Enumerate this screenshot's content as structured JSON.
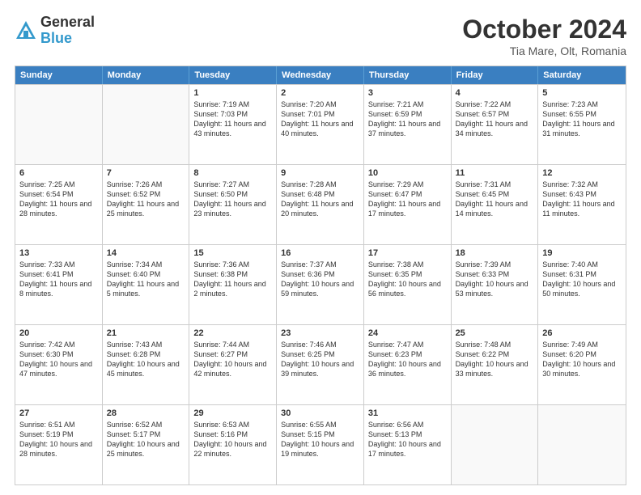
{
  "header": {
    "logo_general": "General",
    "logo_blue": "Blue",
    "month_title": "October 2024",
    "location": "Tia Mare, Olt, Romania"
  },
  "weekdays": [
    "Sunday",
    "Monday",
    "Tuesday",
    "Wednesday",
    "Thursday",
    "Friday",
    "Saturday"
  ],
  "rows": [
    [
      {
        "day": "",
        "text": "",
        "empty": true
      },
      {
        "day": "",
        "text": "",
        "empty": true
      },
      {
        "day": "1",
        "text": "Sunrise: 7:19 AM\nSunset: 7:03 PM\nDaylight: 11 hours and 43 minutes.",
        "empty": false
      },
      {
        "day": "2",
        "text": "Sunrise: 7:20 AM\nSunset: 7:01 PM\nDaylight: 11 hours and 40 minutes.",
        "empty": false
      },
      {
        "day": "3",
        "text": "Sunrise: 7:21 AM\nSunset: 6:59 PM\nDaylight: 11 hours and 37 minutes.",
        "empty": false
      },
      {
        "day": "4",
        "text": "Sunrise: 7:22 AM\nSunset: 6:57 PM\nDaylight: 11 hours and 34 minutes.",
        "empty": false
      },
      {
        "day": "5",
        "text": "Sunrise: 7:23 AM\nSunset: 6:55 PM\nDaylight: 11 hours and 31 minutes.",
        "empty": false
      }
    ],
    [
      {
        "day": "6",
        "text": "Sunrise: 7:25 AM\nSunset: 6:54 PM\nDaylight: 11 hours and 28 minutes.",
        "empty": false
      },
      {
        "day": "7",
        "text": "Sunrise: 7:26 AM\nSunset: 6:52 PM\nDaylight: 11 hours and 25 minutes.",
        "empty": false
      },
      {
        "day": "8",
        "text": "Sunrise: 7:27 AM\nSunset: 6:50 PM\nDaylight: 11 hours and 23 minutes.",
        "empty": false
      },
      {
        "day": "9",
        "text": "Sunrise: 7:28 AM\nSunset: 6:48 PM\nDaylight: 11 hours and 20 minutes.",
        "empty": false
      },
      {
        "day": "10",
        "text": "Sunrise: 7:29 AM\nSunset: 6:47 PM\nDaylight: 11 hours and 17 minutes.",
        "empty": false
      },
      {
        "day": "11",
        "text": "Sunrise: 7:31 AM\nSunset: 6:45 PM\nDaylight: 11 hours and 14 minutes.",
        "empty": false
      },
      {
        "day": "12",
        "text": "Sunrise: 7:32 AM\nSunset: 6:43 PM\nDaylight: 11 hours and 11 minutes.",
        "empty": false
      }
    ],
    [
      {
        "day": "13",
        "text": "Sunrise: 7:33 AM\nSunset: 6:41 PM\nDaylight: 11 hours and 8 minutes.",
        "empty": false
      },
      {
        "day": "14",
        "text": "Sunrise: 7:34 AM\nSunset: 6:40 PM\nDaylight: 11 hours and 5 minutes.",
        "empty": false
      },
      {
        "day": "15",
        "text": "Sunrise: 7:36 AM\nSunset: 6:38 PM\nDaylight: 11 hours and 2 minutes.",
        "empty": false
      },
      {
        "day": "16",
        "text": "Sunrise: 7:37 AM\nSunset: 6:36 PM\nDaylight: 10 hours and 59 minutes.",
        "empty": false
      },
      {
        "day": "17",
        "text": "Sunrise: 7:38 AM\nSunset: 6:35 PM\nDaylight: 10 hours and 56 minutes.",
        "empty": false
      },
      {
        "day": "18",
        "text": "Sunrise: 7:39 AM\nSunset: 6:33 PM\nDaylight: 10 hours and 53 minutes.",
        "empty": false
      },
      {
        "day": "19",
        "text": "Sunrise: 7:40 AM\nSunset: 6:31 PM\nDaylight: 10 hours and 50 minutes.",
        "empty": false
      }
    ],
    [
      {
        "day": "20",
        "text": "Sunrise: 7:42 AM\nSunset: 6:30 PM\nDaylight: 10 hours and 47 minutes.",
        "empty": false
      },
      {
        "day": "21",
        "text": "Sunrise: 7:43 AM\nSunset: 6:28 PM\nDaylight: 10 hours and 45 minutes.",
        "empty": false
      },
      {
        "day": "22",
        "text": "Sunrise: 7:44 AM\nSunset: 6:27 PM\nDaylight: 10 hours and 42 minutes.",
        "empty": false
      },
      {
        "day": "23",
        "text": "Sunrise: 7:46 AM\nSunset: 6:25 PM\nDaylight: 10 hours and 39 minutes.",
        "empty": false
      },
      {
        "day": "24",
        "text": "Sunrise: 7:47 AM\nSunset: 6:23 PM\nDaylight: 10 hours and 36 minutes.",
        "empty": false
      },
      {
        "day": "25",
        "text": "Sunrise: 7:48 AM\nSunset: 6:22 PM\nDaylight: 10 hours and 33 minutes.",
        "empty": false
      },
      {
        "day": "26",
        "text": "Sunrise: 7:49 AM\nSunset: 6:20 PM\nDaylight: 10 hours and 30 minutes.",
        "empty": false
      }
    ],
    [
      {
        "day": "27",
        "text": "Sunrise: 6:51 AM\nSunset: 5:19 PM\nDaylight: 10 hours and 28 minutes.",
        "empty": false
      },
      {
        "day": "28",
        "text": "Sunrise: 6:52 AM\nSunset: 5:17 PM\nDaylight: 10 hours and 25 minutes.",
        "empty": false
      },
      {
        "day": "29",
        "text": "Sunrise: 6:53 AM\nSunset: 5:16 PM\nDaylight: 10 hours and 22 minutes.",
        "empty": false
      },
      {
        "day": "30",
        "text": "Sunrise: 6:55 AM\nSunset: 5:15 PM\nDaylight: 10 hours and 19 minutes.",
        "empty": false
      },
      {
        "day": "31",
        "text": "Sunrise: 6:56 AM\nSunset: 5:13 PM\nDaylight: 10 hours and 17 minutes.",
        "empty": false
      },
      {
        "day": "",
        "text": "",
        "empty": true
      },
      {
        "day": "",
        "text": "",
        "empty": true
      }
    ]
  ]
}
